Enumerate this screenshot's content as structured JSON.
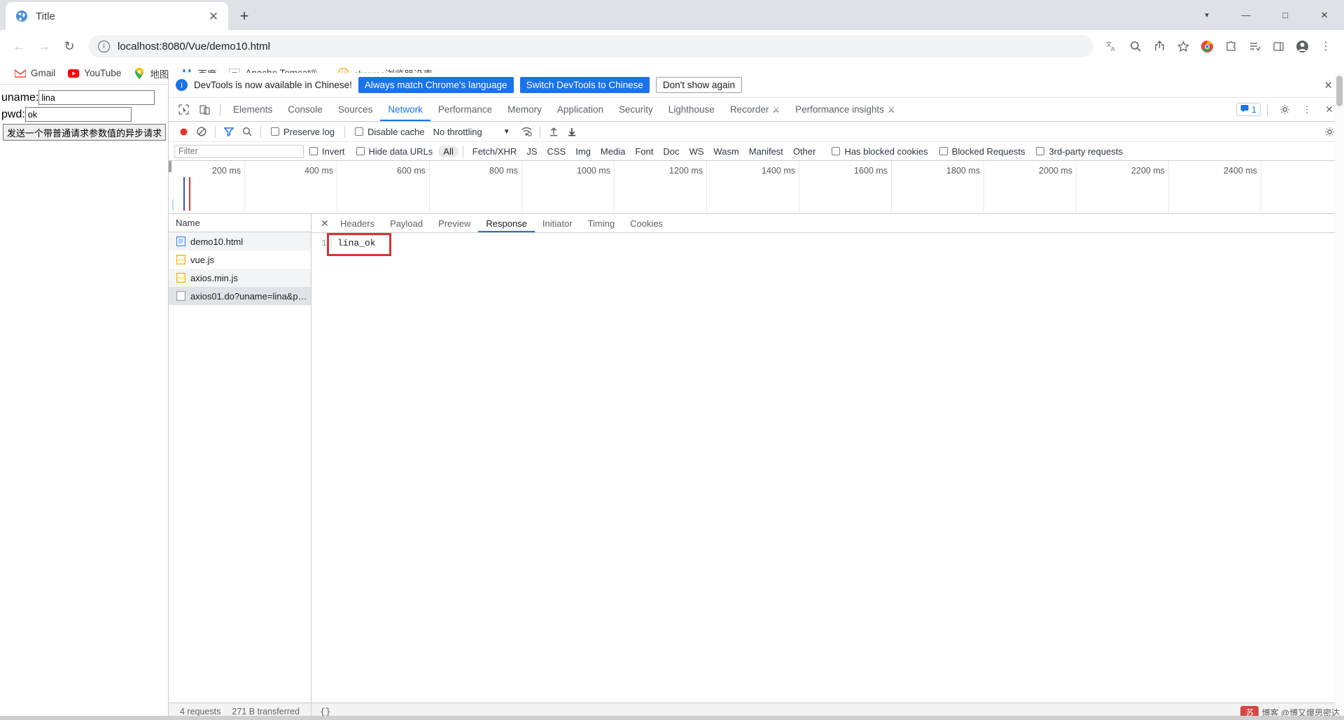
{
  "window": {
    "tab_title": "Title",
    "tab_favicon_icon": "globe-icon",
    "close_tab_icon": "close-icon",
    "new_tab_icon": "plus-icon",
    "minimize_icon": "minimize-icon",
    "maximize_icon": "maximize-icon",
    "close_window_icon": "close-icon",
    "tab_search_icon": "chevron-down-icon"
  },
  "toolbar": {
    "back_icon": "arrow-left-icon",
    "forward_icon": "arrow-right-icon",
    "reload_icon": "reload-icon",
    "site_info_icon": "info-icon",
    "url": "localhost:8080/Vue/demo10.html",
    "translate_icon": "translate-icon",
    "search_icon": "search-icon",
    "share_icon": "share-icon",
    "bookmark_icon": "star-icon",
    "profile_circle_icon": "chrome-circle-icon",
    "extensions_icon": "puzzle-icon",
    "readinglist_icon": "reading-list-icon",
    "sidepanel_icon": "side-panel-icon",
    "avatar_icon": "avatar-icon",
    "menu_icon": "kebab-menu-icon"
  },
  "bookmarks": [
    {
      "label": "Gmail",
      "icon": "gmail-icon"
    },
    {
      "label": "YouTube",
      "icon": "youtube-icon"
    },
    {
      "label": "地图",
      "icon": "google-maps-icon"
    },
    {
      "label": "百度",
      "icon": "baidu-icon"
    },
    {
      "label": "Apache Tomcat®...",
      "icon": "tomcat-icon"
    },
    {
      "label": "chrome浏览器没声...",
      "icon": "chrome-orange-icon"
    }
  ],
  "page": {
    "uname_label": "uname:",
    "uname_value": "lina",
    "pwd_label": "pwd:",
    "pwd_value": "ok",
    "submit_label": "发送一个带普通请求参数值的异步请求"
  },
  "devtools": {
    "banner": {
      "info_icon": "info-icon",
      "message": "DevTools is now available in Chinese!",
      "primary_button": "Always match Chrome's language",
      "secondary_button": "Switch DevTools to Chinese",
      "dismiss_button": "Don't show again",
      "close_icon": "close-icon"
    },
    "inspect_icon": "inspect-cursor-icon",
    "device_toggle_icon": "device-toolbar-icon",
    "tabs": [
      {
        "label": "Elements",
        "active": false
      },
      {
        "label": "Console",
        "active": false
      },
      {
        "label": "Sources",
        "active": false
      },
      {
        "label": "Network",
        "active": true
      },
      {
        "label": "Performance",
        "active": false
      },
      {
        "label": "Memory",
        "active": false
      },
      {
        "label": "Application",
        "active": false
      },
      {
        "label": "Security",
        "active": false
      },
      {
        "label": "Lighthouse",
        "active": false
      },
      {
        "label": "Recorder",
        "active": false,
        "beaker": true
      },
      {
        "label": "Performance insights",
        "active": false,
        "beaker": true
      }
    ],
    "message_badge_icon": "message-icon",
    "message_badge_count": "1",
    "settings_icon": "gear-icon",
    "more_icon": "kebab-menu-icon",
    "close_devtools_icon": "close-icon",
    "network_toolbar": {
      "record_icon": "record-icon",
      "clear_icon": "clear-icon",
      "filter_icon": "filter-icon",
      "search_icon": "search-icon",
      "preserve_log_label": "Preserve log",
      "disable_cache_label": "Disable cache",
      "throttling_value": "No throttling",
      "dropdown_icon": "chevron-down-icon",
      "wifi_icon": "network-conditions-icon",
      "import_icon": "upload-icon",
      "export_icon": "download-icon",
      "settings_icon": "gear-icon"
    },
    "filter_bar": {
      "filter_placeholder": "Filter",
      "invert_label": "Invert",
      "hide_data_urls_label": "Hide data URLs",
      "types": [
        "All",
        "Fetch/XHR",
        "JS",
        "CSS",
        "Img",
        "Media",
        "Font",
        "Doc",
        "WS",
        "Wasm",
        "Manifest",
        "Other"
      ],
      "active_type": "All",
      "has_blocked_cookies_label": "Has blocked cookies",
      "blocked_requests_label": "Blocked Requests",
      "third_party_label": "3rd-party requests"
    },
    "timeline": {
      "ticks": [
        "200 ms",
        "400 ms",
        "600 ms",
        "800 ms",
        "1000 ms",
        "1200 ms",
        "1400 ms",
        "1600 ms",
        "1800 ms",
        "2000 ms",
        "2200 ms",
        "2400 ms"
      ]
    },
    "requests": {
      "column_header": "Name",
      "rows": [
        {
          "name": "demo10.html",
          "icon": "document-icon",
          "selected": false
        },
        {
          "name": "vue.js",
          "icon": "script-icon",
          "selected": false
        },
        {
          "name": "axios.min.js",
          "icon": "script-icon",
          "selected": false
        },
        {
          "name": "axios01.do?uname=lina&pwd...",
          "icon": "xhr-icon",
          "selected": true
        }
      ]
    },
    "detail": {
      "close_icon": "close-icon",
      "tabs": [
        {
          "label": "Headers",
          "active": false
        },
        {
          "label": "Payload",
          "active": false
        },
        {
          "label": "Preview",
          "active": false
        },
        {
          "label": "Response",
          "active": true
        },
        {
          "label": "Initiator",
          "active": false
        },
        {
          "label": "Timing",
          "active": false
        },
        {
          "label": "Cookies",
          "active": false
        }
      ],
      "response_line_number": "1",
      "response_body": "lina_ok",
      "highlight_color": "#e03030"
    },
    "status_bar": {
      "requests_count": "4 requests",
      "transferred": "271 B transferred",
      "resources": "4",
      "format_icon_label": "{}"
    }
  },
  "watermark": {
    "logo_text": "苏",
    "text": "博客 @博又爆思密达"
  }
}
